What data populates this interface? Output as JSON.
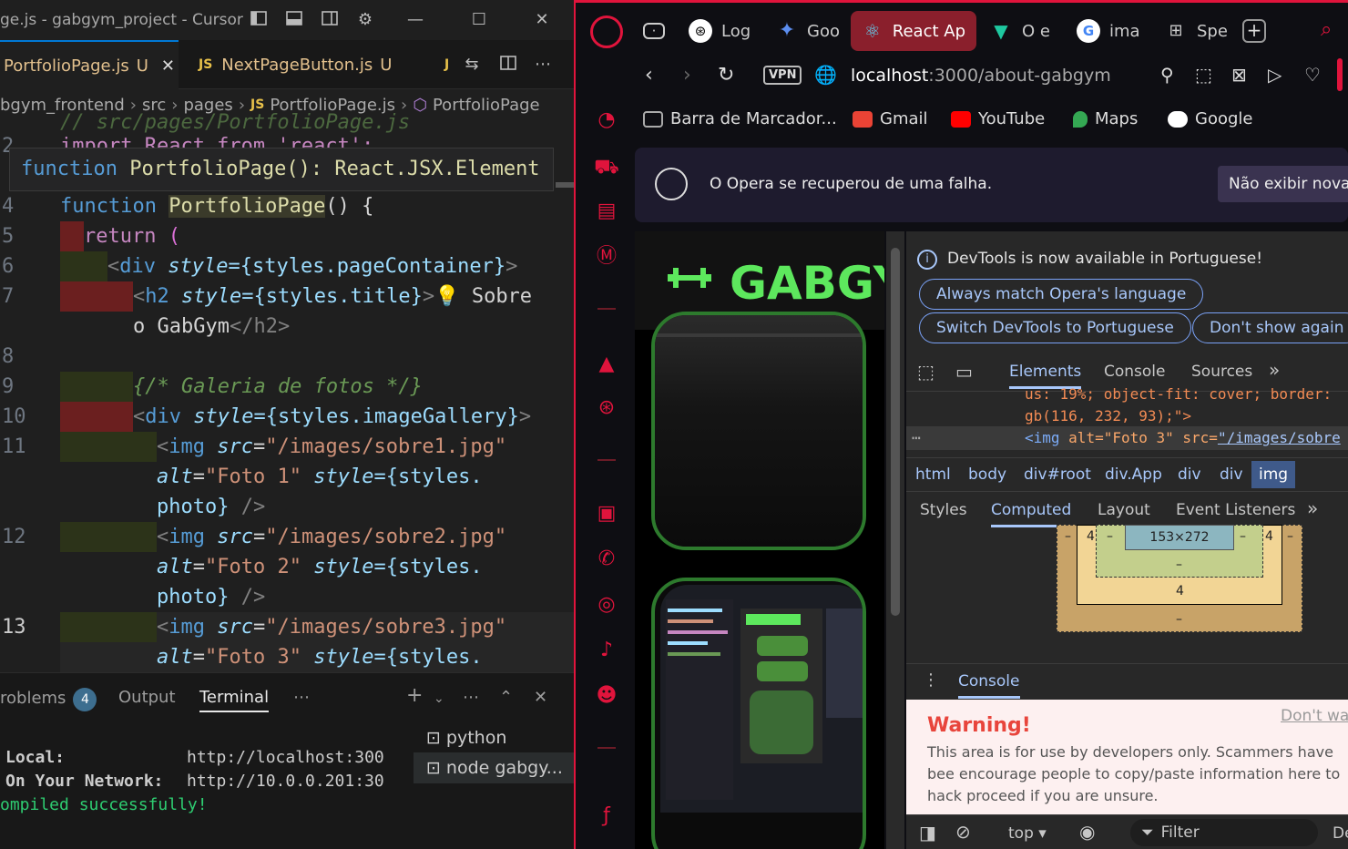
{
  "vscode": {
    "window_title": "ge.js - gabgym_project - Cursor",
    "tabs": [
      {
        "icon": "JS",
        "label": "PortfolioPage.js",
        "status": "U",
        "active": true
      },
      {
        "icon": "JS",
        "label": "NextPageButton.js",
        "status": "U",
        "active": false
      },
      {
        "icon": "J",
        "label": "",
        "status": "",
        "active": false
      }
    ],
    "breadcrumb": [
      "bgym_frontend",
      "src",
      "pages",
      "PortfolioPage.js",
      "PortfolioPage"
    ],
    "sticky_header": {
      "kw": "function",
      "name": "PortfolioPage",
      "sig": "(): React.JSX.Element"
    },
    "partial_lines": {
      "line2_hint": "// src/pages/PortfolioPage.js",
      "line3_hint": "import React from 'react';"
    },
    "code": {
      "l4": {
        "num": "4",
        "kw": "function",
        "fn": "PortfolioPage",
        "rest": "() {"
      },
      "l5": {
        "num": "5",
        "kw": "return",
        "rest": " ("
      },
      "l6": {
        "num": "6",
        "open": "<",
        "tag": "div",
        "attr": "style",
        "val": "={styles.pageContainer}",
        "close": ">"
      },
      "l7": {
        "num": "7",
        "open": "<",
        "tag": "h2",
        "attr": "style",
        "val": "={styles.title}",
        "close": ">",
        "text": " Sobre"
      },
      "l7b": {
        "text": "o GabGym",
        "endtag": "</h2>"
      },
      "l8": {
        "num": "8"
      },
      "l9": {
        "num": "9",
        "comment": "{/* Galeria de fotos */}"
      },
      "l10": {
        "num": "10",
        "open": "<",
        "tag": "div",
        "attr": "style",
        "val": "={styles.imageGallery}",
        "close": ">"
      },
      "img1": {
        "num": "11",
        "src_attr": "src",
        "src": "\"/images/sobre1.jpg\"",
        "alt_attr": "alt",
        "alt": "\"Foto 1\"",
        "style_attr": "style",
        "style_val": "={styles.",
        "style_tail": "photo}",
        "end": " />"
      },
      "img2": {
        "num": "12",
        "src_attr": "src",
        "src": "\"/images/sobre2.jpg\"",
        "alt_attr": "alt",
        "alt": "\"Foto 2\"",
        "style_attr": "style",
        "style_val": "={styles.",
        "style_tail": "photo}",
        "end": " />"
      },
      "img3": {
        "num": "13",
        "src_attr": "src",
        "src": "\"/images/sobre3.jpg\"",
        "alt_attr": "alt",
        "alt": "\"Foto 3\"",
        "style_attr": "style",
        "style_val": "={styles."
      }
    },
    "panel": {
      "tabs": [
        "roblems",
        "Output",
        "Terminal"
      ],
      "problems_count": "4",
      "terminal_lines": [
        {
          "label": "Local:",
          "value": "http://localhost:300"
        },
        {
          "label": "On Your Network:",
          "value": "http://10.0.0.201:30"
        }
      ],
      "compiled": "ompiled successfully!",
      "terminals": [
        {
          "label": "python"
        },
        {
          "label": "node gabgy..."
        }
      ]
    }
  },
  "opera": {
    "tabs": [
      {
        "label": "",
        "icon": "game-controller"
      },
      {
        "label": "Log",
        "icon": "openai"
      },
      {
        "label": "Goo",
        "icon": "gemini-star"
      },
      {
        "label": "React Ap",
        "icon": "react",
        "active": true
      },
      {
        "label": "O e",
        "icon": "vuetify"
      },
      {
        "label": "ima",
        "icon": "google"
      },
      {
        "label": "Spe",
        "icon": "grid"
      }
    ],
    "vpn": "VPN",
    "url_host": "localhost",
    "url_rest": ":3000/about-gabgym",
    "bookmarks": [
      {
        "label": "Barra de Marcador...",
        "color": "#888888"
      },
      {
        "label": "Gmail",
        "color": "#ea4335"
      },
      {
        "label": "YouTube",
        "color": "#ff0000"
      },
      {
        "label": "Maps",
        "color": "#34a853"
      },
      {
        "label": "Google",
        "color": "#4285f4"
      }
    ],
    "infobar": {
      "message": "O Opera se recuperou de uma falha.",
      "button": "Não exibir nova"
    },
    "page": {
      "logo_text": "GABGY",
      "accent": "#5de85d"
    },
    "devtools": {
      "lang_notice": "DevTools is now available in Portuguese!",
      "buttons": [
        "Always match Opera's language",
        "Switch DevTools to Portuguese",
        "Don't show again"
      ],
      "tabs": [
        "Elements",
        "Console",
        "Sources"
      ],
      "html_lines": [
        "us: 19%; object-fit: cover; border:",
        "gb(116, 232, 93);\">"
      ],
      "img_line": {
        "tag": "<img",
        "alt": "alt=\"Foto 3\"",
        "src_attr": "src=",
        "src": "\"/images/sobre"
      },
      "crumbs": [
        "html",
        "body",
        "div#root",
        "div.App",
        "div",
        "div",
        "img"
      ],
      "sub_tabs": [
        "Styles",
        "Computed",
        "Layout",
        "Event Listeners"
      ],
      "box_model": {
        "content": "153×272",
        "left": "4",
        "right": "4",
        "bottom": "4",
        "dash": "–"
      },
      "console_label": "Console",
      "warning_title": "Warning!",
      "warning_link": "Don't war",
      "warning_text": "This area is for use by developers only. Scammers have bee encourage people to copy/paste information here to hack proceed if you are unsure.",
      "footer": {
        "context": "top",
        "filter": "Filter",
        "levels": "De"
      }
    }
  }
}
